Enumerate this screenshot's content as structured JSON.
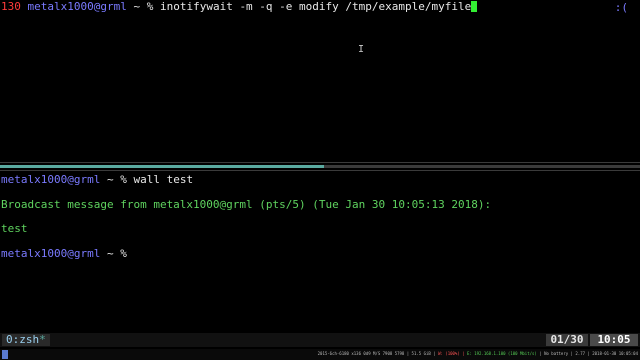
{
  "top_pane": {
    "exit_code": "130",
    "user_host": "metalx1000@grml",
    "path_prompt": " ~ % ",
    "command": "inotifywait -m -q -e modify /tmp/example/myfile",
    "status_face": ":("
  },
  "bottom_pane": {
    "line1_user": "metalx1000@grml",
    "line1_prompt": " ~ % ",
    "line1_cmd": "wall test",
    "broadcast": "Broadcast message from metalx1000@grml (pts/5) (Tue Jan 30 10:05:13 2018):",
    "message": "test",
    "line4_user": "metalx1000@grml",
    "line4_prompt": " ~ % "
  },
  "statusbar": {
    "window_label": "0:zsh",
    "window_flag": "*",
    "page_count": "01/30",
    "clock": "10:05"
  },
  "taskbar": {
    "tray_cpu": "2015-6ch-6180 x136 0d9 M/S 7908 5798 | 51.5 GiB |",
    "tray_net_down": "W: (100%) |",
    "tray_net_up": "E: 192.168.1.100 (100 Mbit/s)",
    "tray_battery": "| No battery | 2.77 | 2018-01-30 10:05:04"
  }
}
